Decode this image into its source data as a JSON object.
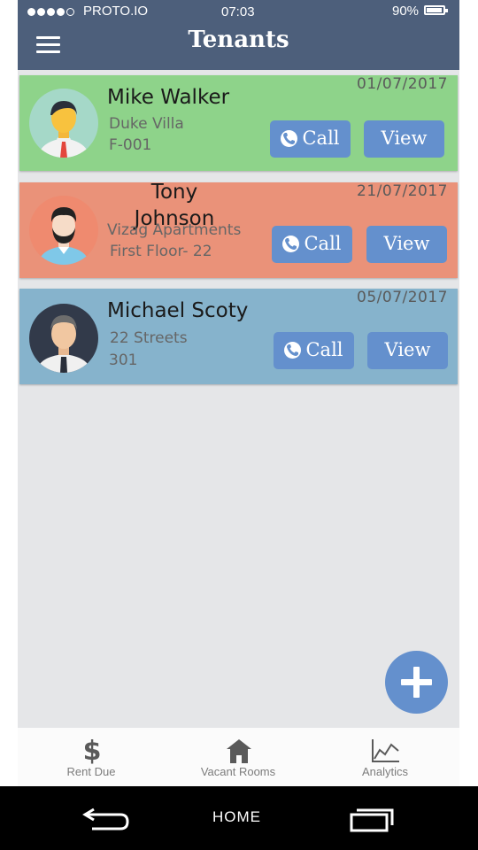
{
  "status_bar": {
    "carrier": "PROTO.IO",
    "time": "07:03",
    "battery": "90%"
  },
  "header": {
    "title": "Tenants",
    "menu_icon": "hamburger-menu-icon"
  },
  "tenants": [
    {
      "name": "Mike Walker",
      "property": "Duke Villa",
      "unit": "F-001",
      "date": "01/07/2017",
      "call_label": "Call",
      "view_label": "View",
      "card_color": "#8ed38a",
      "avatar_bg": "#a5d8c8"
    },
    {
      "name": "Tony Johnson",
      "property": "Vizag Apartments",
      "unit": "First Floor- 22",
      "date": "21/07/2017",
      "call_label": "Call",
      "view_label": "View",
      "card_color": "#ea9279",
      "avatar_bg": "#ef8a6f"
    },
    {
      "name": "Michael Scoty",
      "property": "22 Streets",
      "unit": "301",
      "date": "05/07/2017",
      "call_label": "Call",
      "view_label": "View",
      "card_color": "#86b3cc",
      "avatar_bg": "#323a4a"
    }
  ],
  "fab": {
    "icon": "plus-icon"
  },
  "tabs": [
    {
      "label": "Rent Due",
      "icon": "dollar-icon"
    },
    {
      "label": "Vacant Rooms",
      "icon": "house-icon"
    },
    {
      "label": "Analytics",
      "icon": "line-chart-icon"
    }
  ],
  "android_nav": {
    "home_label": "HOME",
    "back_icon": "back-arrow-icon",
    "recents_icon": "recent-apps-icon"
  },
  "colors": {
    "header": "#4d5f7b",
    "button": "#6490cd",
    "background": "#e5e6e8"
  }
}
